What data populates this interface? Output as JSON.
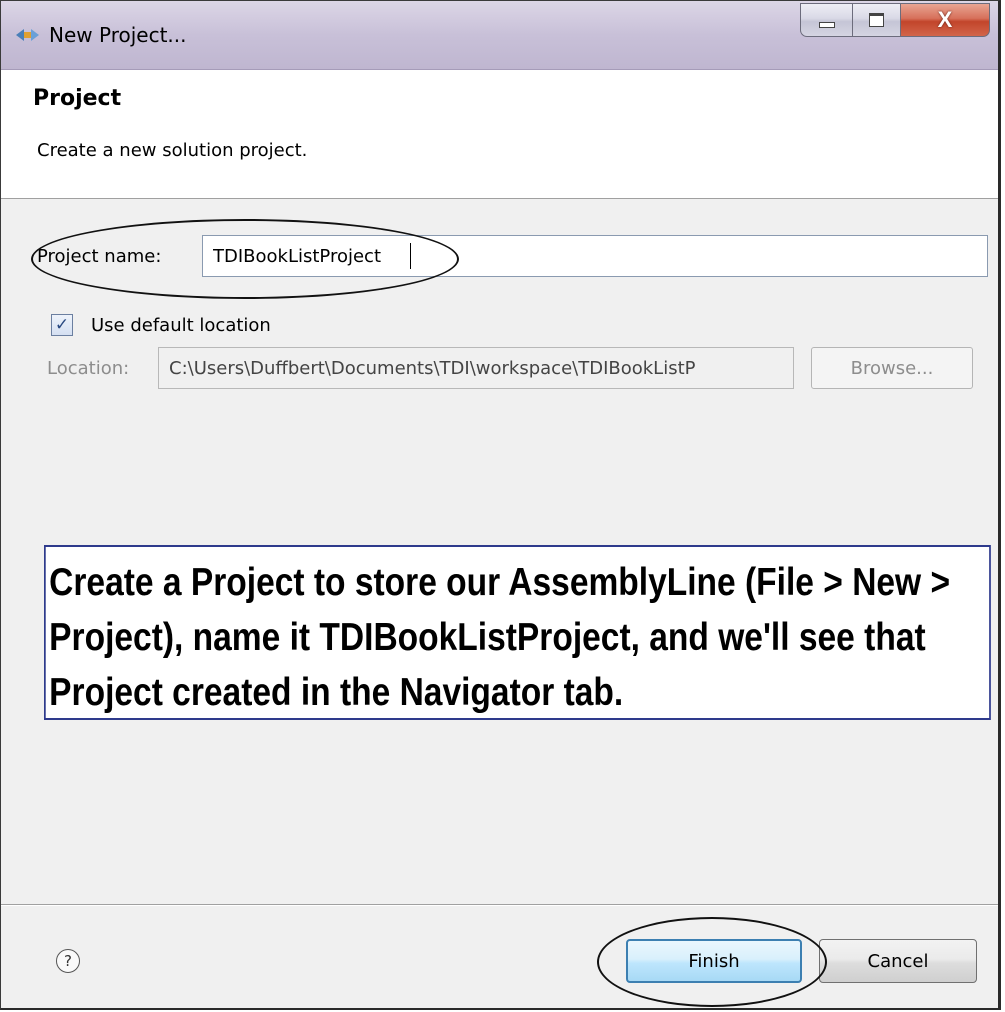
{
  "window": {
    "title": "New Project...",
    "icon": "new-project-icon",
    "controls": {
      "minimize": "minimize-icon",
      "maximize": "maximize-icon",
      "close": "X"
    }
  },
  "header": {
    "title": "Project",
    "description": "Create a new solution project."
  },
  "form": {
    "project_name_label": "Project name:",
    "project_name_value": "TDIBookListProject",
    "use_default_location_label": "Use default location",
    "use_default_location_checked": true,
    "checkbox_mark": "✓",
    "location_label": "Location:",
    "location_value": "C:\\Users\\Duffbert\\Documents\\TDI\\workspace\\TDIBookListP",
    "browse_label": "Browse..."
  },
  "annotation": {
    "text": "Create a Project to store our AssemblyLine (File > New > Project), name it TDIBookListProject, and we'll see that Project created in the Navigator tab."
  },
  "footer": {
    "help_glyph": "?",
    "finish_label": "Finish",
    "cancel_label": "Cancel"
  }
}
